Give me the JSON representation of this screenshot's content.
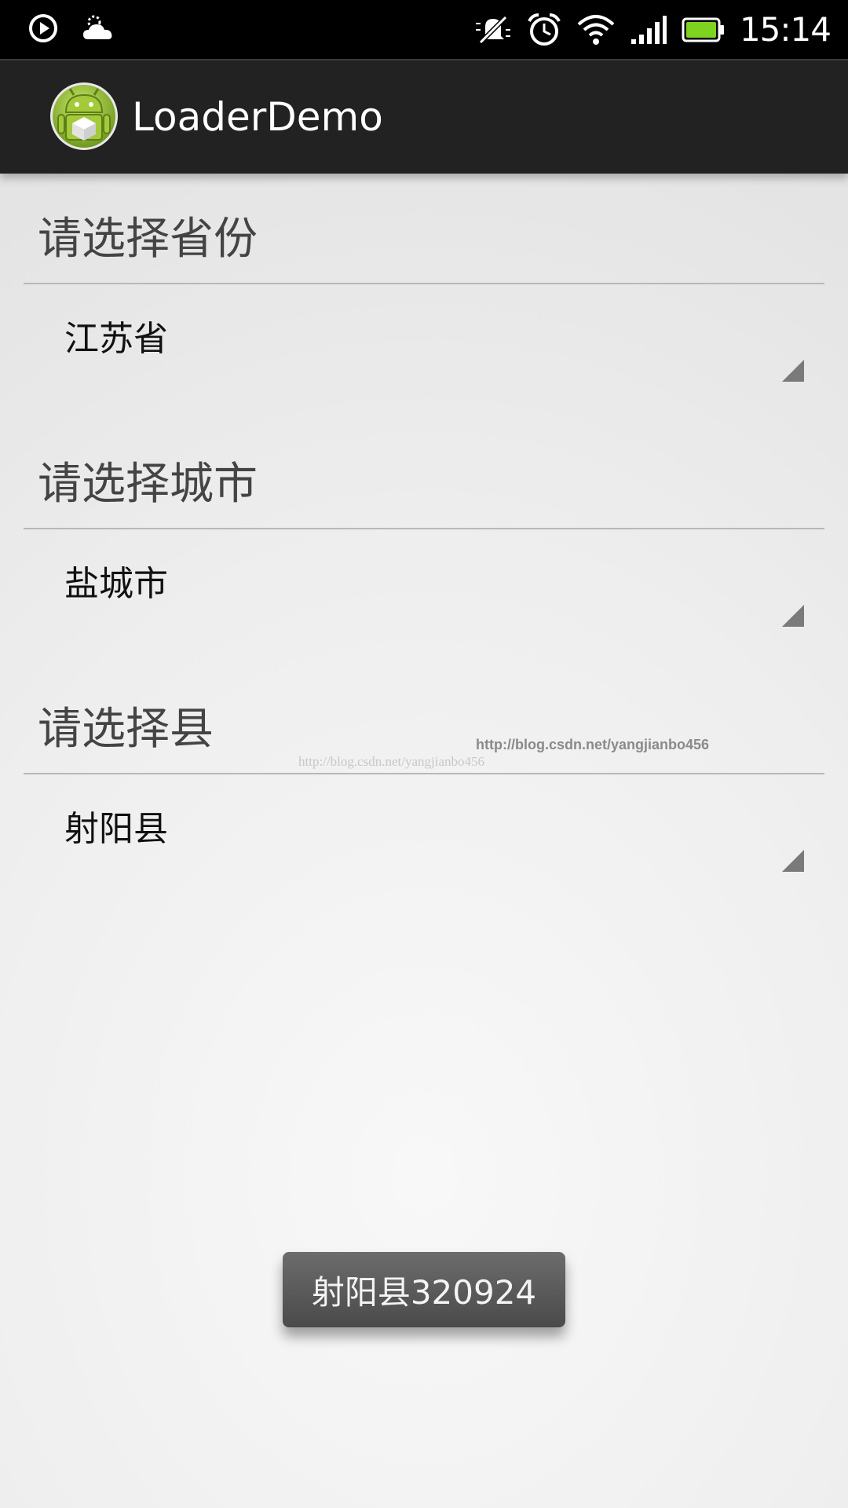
{
  "status_bar": {
    "time": "15:14",
    "left_icons": [
      "play-icon",
      "weather-icon"
    ],
    "right_icons": [
      "vibrate-muted-icon",
      "alarm-icon",
      "wifi-icon",
      "cell-signal-icon",
      "battery-icon"
    ],
    "battery_color": "#7ed321"
  },
  "action_bar": {
    "title": "LoaderDemo",
    "background": "#222222"
  },
  "sections": [
    {
      "header": "请选择省份",
      "selected": "江苏省"
    },
    {
      "header": "请选择城市",
      "selected": "盐城市"
    },
    {
      "header": "请选择县",
      "selected": "射阳县"
    }
  ],
  "watermark": {
    "primary": "http://blog.csdn.net/yangjianbo456",
    "secondary": "http://blog.csdn.net/yangjianbo456"
  },
  "toast": {
    "text": "射阳县320924"
  }
}
